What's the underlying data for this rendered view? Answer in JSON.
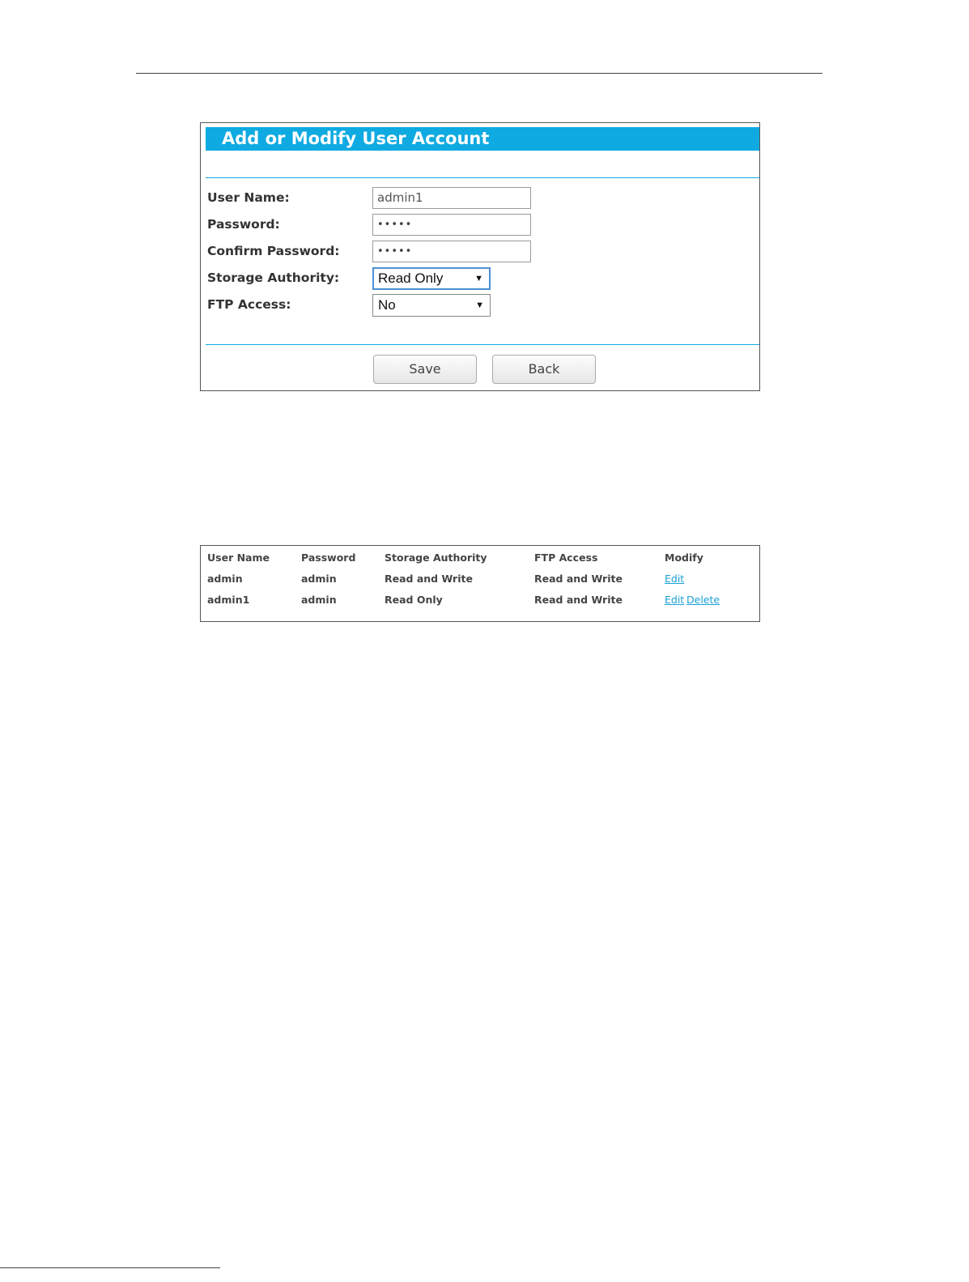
{
  "form": {
    "title": "Add or Modify User Account",
    "username_label": "User Name:",
    "username_value": "admin1",
    "password_label": "Password:",
    "password_value": "•••••",
    "confirm_label": "Confirm Password:",
    "confirm_value": "•••••",
    "storage_label": "Storage Authority:",
    "storage_selected": "Read Only",
    "ftp_label": "FTP Access:",
    "ftp_selected": "No",
    "save_label": "Save",
    "back_label": "Back",
    "accent_color": "#0faae1"
  },
  "table": {
    "headers": [
      "User Name",
      "Password",
      "Storage Authority",
      "FTP Access",
      "Modify"
    ],
    "rows": [
      {
        "user": "admin",
        "password": "admin",
        "storage": "Read and Write",
        "ftp": "Read and Write",
        "edit": "Edit"
      },
      {
        "user": "admin1",
        "password": "admin",
        "storage": "Read Only",
        "ftp": "Read and Write",
        "edit": "Edit",
        "delete": "Delete"
      }
    ],
    "link_color": "#1aa0d6"
  }
}
